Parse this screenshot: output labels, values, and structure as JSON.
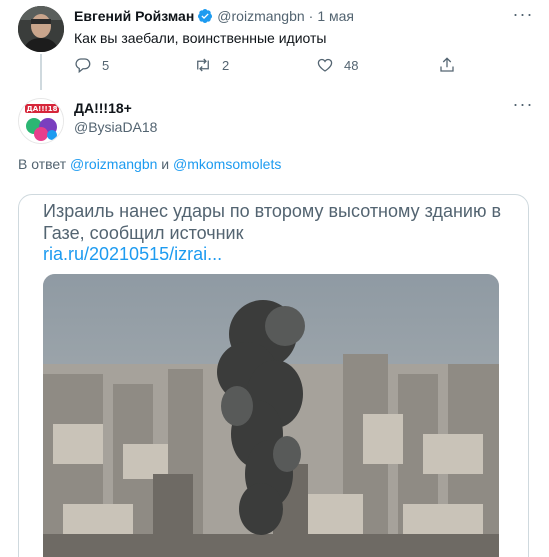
{
  "tweet1": {
    "author_name": "Евгений Ройзман",
    "handle": "@roizmangbn",
    "separator": "·",
    "time": "1 мая",
    "text": "Как вы заебали, воинственные идиоты",
    "replies": "5",
    "retweets": "2",
    "likes": "48",
    "more": "···"
  },
  "tweet2": {
    "author_name": "ДА!!!18+",
    "handle": "@BysiaDA18",
    "more": "···",
    "reply_prefix": "В ответ",
    "reply_to_1": "@roizmangbn",
    "reply_joiner": "и",
    "reply_to_2": "@mkomsomolets",
    "card": {
      "title": "Израиль нанес удары по второму высотному зданию в Газе, сообщил источник",
      "link": "ria.ru/20210515/izrai..."
    }
  },
  "colors": {
    "accent": "#1d9bf0",
    "secondary_text": "#536471",
    "border": "#cfd9de"
  },
  "icons": [
    "verified-badge-icon",
    "reply-icon",
    "retweet-icon",
    "like-icon",
    "share-icon",
    "more-icon"
  ]
}
